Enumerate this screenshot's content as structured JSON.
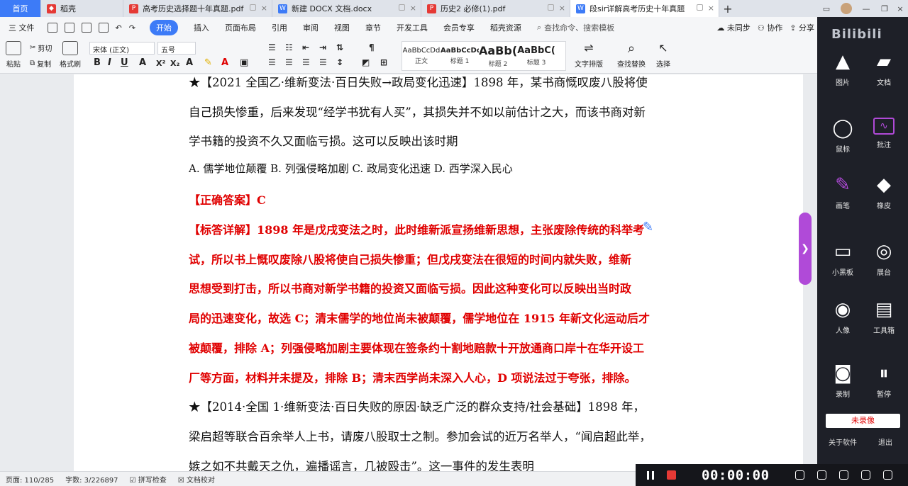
{
  "tabs": [
    {
      "label": "首页",
      "type": "home"
    },
    {
      "label": "稻壳",
      "icon": "docer-icon",
      "color": "#e53935"
    },
    {
      "label": "高考历史选择题十年真题.pdf",
      "icon": "pdf-icon",
      "color": "#e53935"
    },
    {
      "label": "新建 DOCX 文档.docx",
      "icon": "word-icon",
      "color": "#3d7bf7"
    },
    {
      "label": "历史2 必修(1).pdf",
      "icon": "pdf-icon",
      "color": "#e53935"
    },
    {
      "label": "段sir详解高考历史十年真题",
      "icon": "word-icon",
      "color": "#3d7bf7",
      "active": true
    }
  ],
  "menu": {
    "file": "三 文件",
    "items": [
      "开始",
      "插入",
      "页面布局",
      "引用",
      "审阅",
      "视图",
      "章节",
      "开发工具",
      "会员专享",
      "稻壳资源"
    ],
    "search": "查找命令、搜索模板",
    "sync": "未同步",
    "collab": "协作",
    "share": "分享"
  },
  "ribbon": {
    "paste": "粘贴",
    "cut": "剪切",
    "copy": "复制",
    "format_painter": "格式刷",
    "font_name": "宋体 (正文)",
    "font_size": "五号",
    "styles": [
      {
        "preview": "AaBbCcDd",
        "name": "正文"
      },
      {
        "preview": "AaBbCcDd",
        "name": "标题 1"
      },
      {
        "preview": "AaBb(",
        "name": "标题 2"
      },
      {
        "preview": "AaBbC(",
        "name": "标题 3"
      }
    ],
    "text_layout": "文字排版",
    "find_replace": "查找替换",
    "select": "选择"
  },
  "document": {
    "lines": [
      {
        "text": "★【2021 全国乙·维新变法·百日失败→政局变化迅速】1898 年，某书商慨叹废八股将使",
        "red": false
      },
      {
        "text": "自己损失惨重，后来发现“经学书犹有人买”，其损失并不如以前估计之大，而该书商对新",
        "red": false
      },
      {
        "text": "学书籍的投资不久又面临亏损。这可以反映出该时期",
        "red": false
      },
      {
        "text": "A.  儒学地位颠覆  B.  列强侵略加剧   C.  政局变化迅速      D.  西学深入民心",
        "red": false
      },
      {
        "text": "【正确答案】C",
        "red": true
      },
      {
        "text": "【标答详解】1898 年是戊戌变法之时，此时维新派宣扬维新思想，主张废除传统的科举考",
        "red": true
      },
      {
        "text": "试，所以书上慨叹废除八股将使自己损失惨重；但戊戌变法在很短的时间内就失败，维新",
        "red": true
      },
      {
        "text": "思想受到打击，所以书商对新学书籍的投资又面临亏损。因此这种变化可以反映出当时政",
        "red": true
      },
      {
        "text": "局的迅速变化，故选 C；清末儒学的地位尚未被颠覆，儒学地位在 1915 年新文化运动后才",
        "red": true
      },
      {
        "text": "被颠覆，排除 A；列强侵略加剧主要体现在签条约十割地赔款十开放通商口岸十在华开设工",
        "red": true
      },
      {
        "text": "厂等方面，材料并未提及，排除 B；清末西学尚未深入人心，D 项说法过于夸张，排除。",
        "red": true
      },
      {
        "text": "★【2014·全国 1·维新变法·百日失败的原因·缺乏广泛的群众支持/社会基础】1898 年，",
        "red": false
      },
      {
        "text": "梁启超等联合百余举人上书，请废八股取士之制。参加会试的近万名举人，“闻启超此举，",
        "red": false
      },
      {
        "text": "嫉之如不共戴天之仇，遍播谣言，几被殴击”。这一事件的发生表明",
        "red": false
      }
    ]
  },
  "right_panel": {
    "title": "Bilibili",
    "items": [
      {
        "label": "图片",
        "icon": "image-icon"
      },
      {
        "label": "文档",
        "icon": "folder-icon"
      },
      {
        "label": "鼠标",
        "icon": "mouse-icon"
      },
      {
        "label": "批注",
        "icon": "annotation-icon"
      },
      {
        "label": "画笔",
        "icon": "brush-icon"
      },
      {
        "label": "橡皮",
        "icon": "eraser-icon"
      },
      {
        "label": "小黑板",
        "icon": "blackboard-icon"
      },
      {
        "label": "展台",
        "icon": "camera-stand-icon"
      },
      {
        "label": "人像",
        "icon": "camera-icon"
      },
      {
        "label": "工具箱",
        "icon": "toolbox-icon"
      },
      {
        "label": "录制",
        "icon": "record-icon"
      },
      {
        "label": "暂停",
        "icon": "pause-icon"
      }
    ],
    "not_recording": "未录像",
    "about": "关于软件",
    "exit": "退出"
  },
  "status": {
    "page": "页面: 110/285",
    "words": "字数: 3/226897",
    "spellcheck": "拼写检查",
    "proof": "文档校对"
  },
  "recorder": {
    "time": "00:00:00"
  }
}
